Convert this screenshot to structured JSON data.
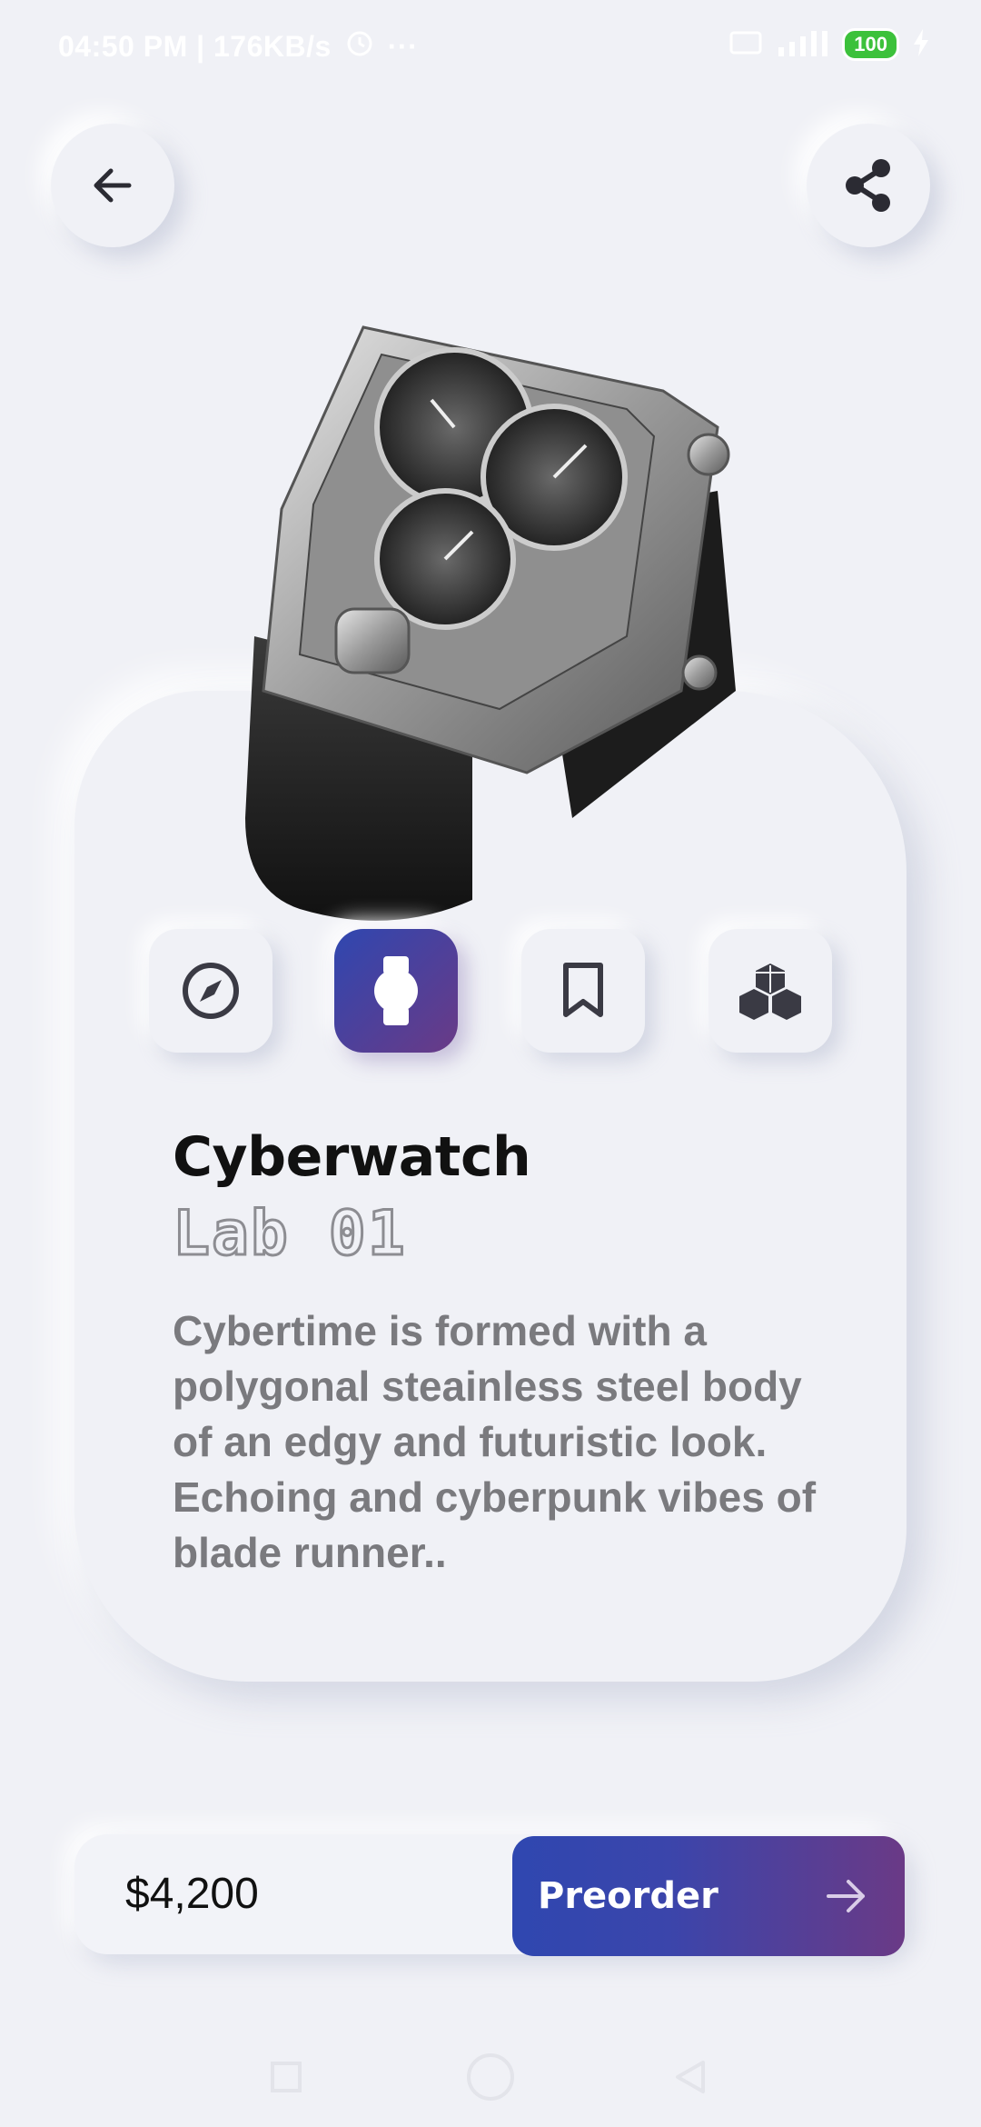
{
  "status_bar": {
    "time_speed": "04:50 PM | 176KB/s",
    "more": "···",
    "battery": "100"
  },
  "icons": {
    "back": "arrow-left-icon",
    "share": "share-icon",
    "features": [
      "compass-icon",
      "watch-icon",
      "bookmark-icon",
      "cubes-icon"
    ]
  },
  "product": {
    "title": "Cyberwatch",
    "subtitle": "Lab 01",
    "description": "Cybertime is formed with a polygonal steainless steel body of an edgy and futuristic look. Echoing and cyberpunk vibes of blade runner.."
  },
  "checkout": {
    "price": "$4,200",
    "preorder_label": "Preorder"
  },
  "colors": {
    "background": "#f0f1f6",
    "accent_start": "#2f47b0",
    "accent_end": "#6a3a86"
  }
}
